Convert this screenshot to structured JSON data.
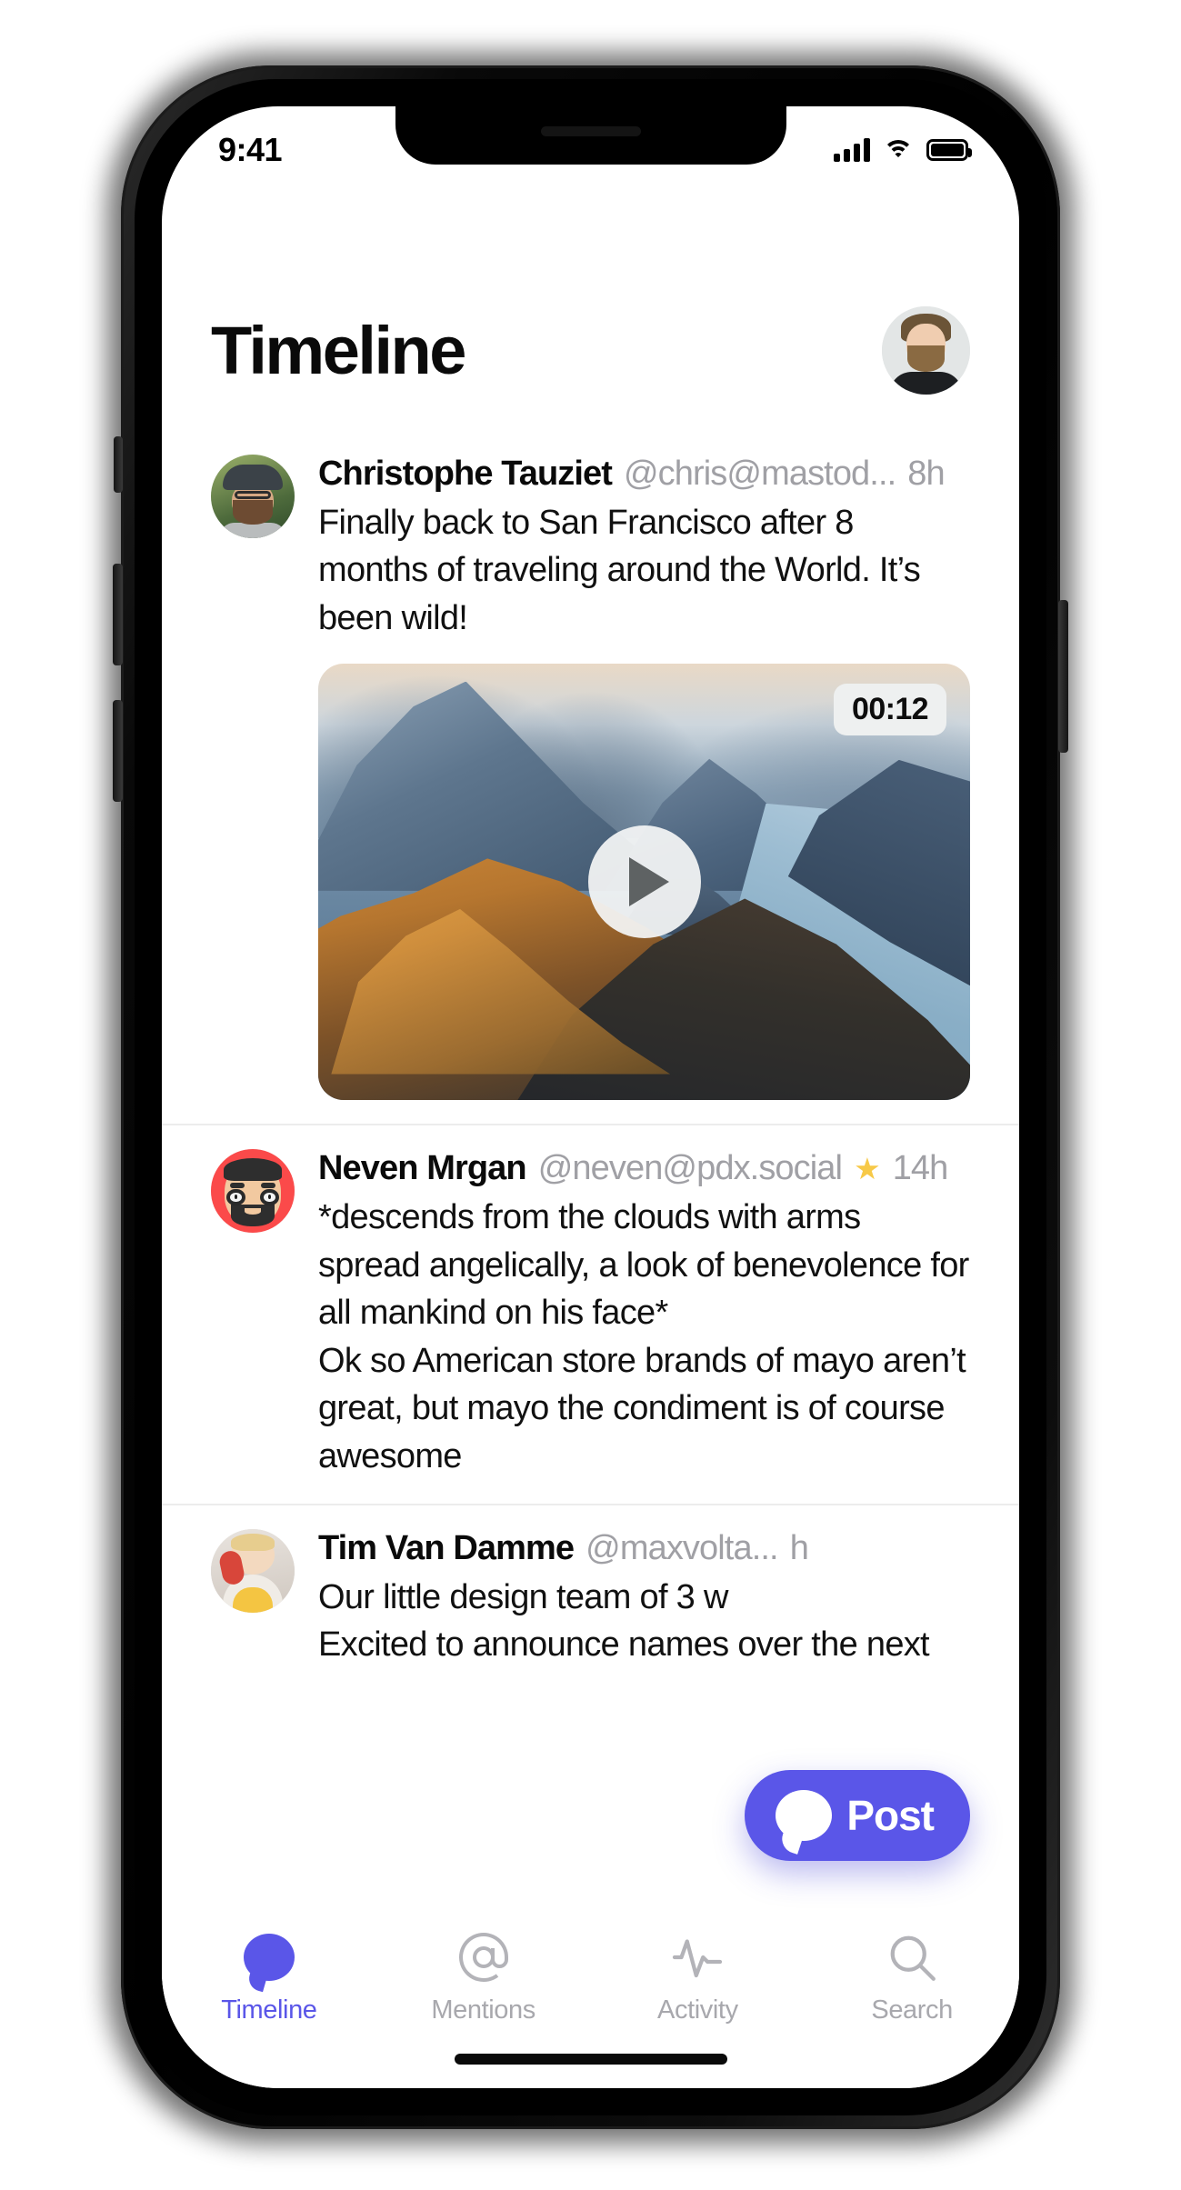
{
  "status_bar": {
    "time": "9:41",
    "icons": [
      "cellular-signal-icon",
      "wifi-icon",
      "battery-icon"
    ]
  },
  "header": {
    "title": "Timeline",
    "avatar_alt": "profile-avatar"
  },
  "theme": {
    "accent": "#5a56e8",
    "muted_text": "#a0a0a5",
    "text": "#111111",
    "star": "#f7c948",
    "background": "#ffffff"
  },
  "feed": {
    "posts": [
      {
        "name": "Christophe Tauziet",
        "handle": "@chris@mastod...",
        "time": "8h",
        "starred": false,
        "text": "Finally back to San Francisco after 8 months of traveling around the World. It’s been wild!",
        "media": {
          "type": "video",
          "duration": "00:12",
          "play_icon": "play-icon",
          "alt": "mountain-ridge-and-lake-at-sunrise"
        }
      },
      {
        "name": "Neven Mrgan",
        "handle": "@neven@pdx.social",
        "time": "14h",
        "starred": true,
        "star_icon": "star-icon",
        "text": "*descends from the clouds with arms spread angelically, a look of benevolence for all mankind on his face*\nOk so American store brands of mayo aren’t great, but mayo the condiment is of course awesome"
      },
      {
        "name": "Tim Van Damme",
        "handle": "@maxvolta...",
        "time": "h",
        "starred": false,
        "text": "Our little design team of 3 w\nExcited to announce names over the next"
      }
    ]
  },
  "compose": {
    "label": "Post",
    "icon": "speech-bubble-icon"
  },
  "tab_bar": {
    "tabs": [
      {
        "label": "Timeline",
        "icon": "speech-bubble-icon",
        "active": true
      },
      {
        "label": "Mentions",
        "icon": "at-sign-icon",
        "active": false
      },
      {
        "label": "Activity",
        "icon": "pulse-icon",
        "active": false
      },
      {
        "label": "Search",
        "icon": "magnifier-icon",
        "active": false
      }
    ]
  }
}
